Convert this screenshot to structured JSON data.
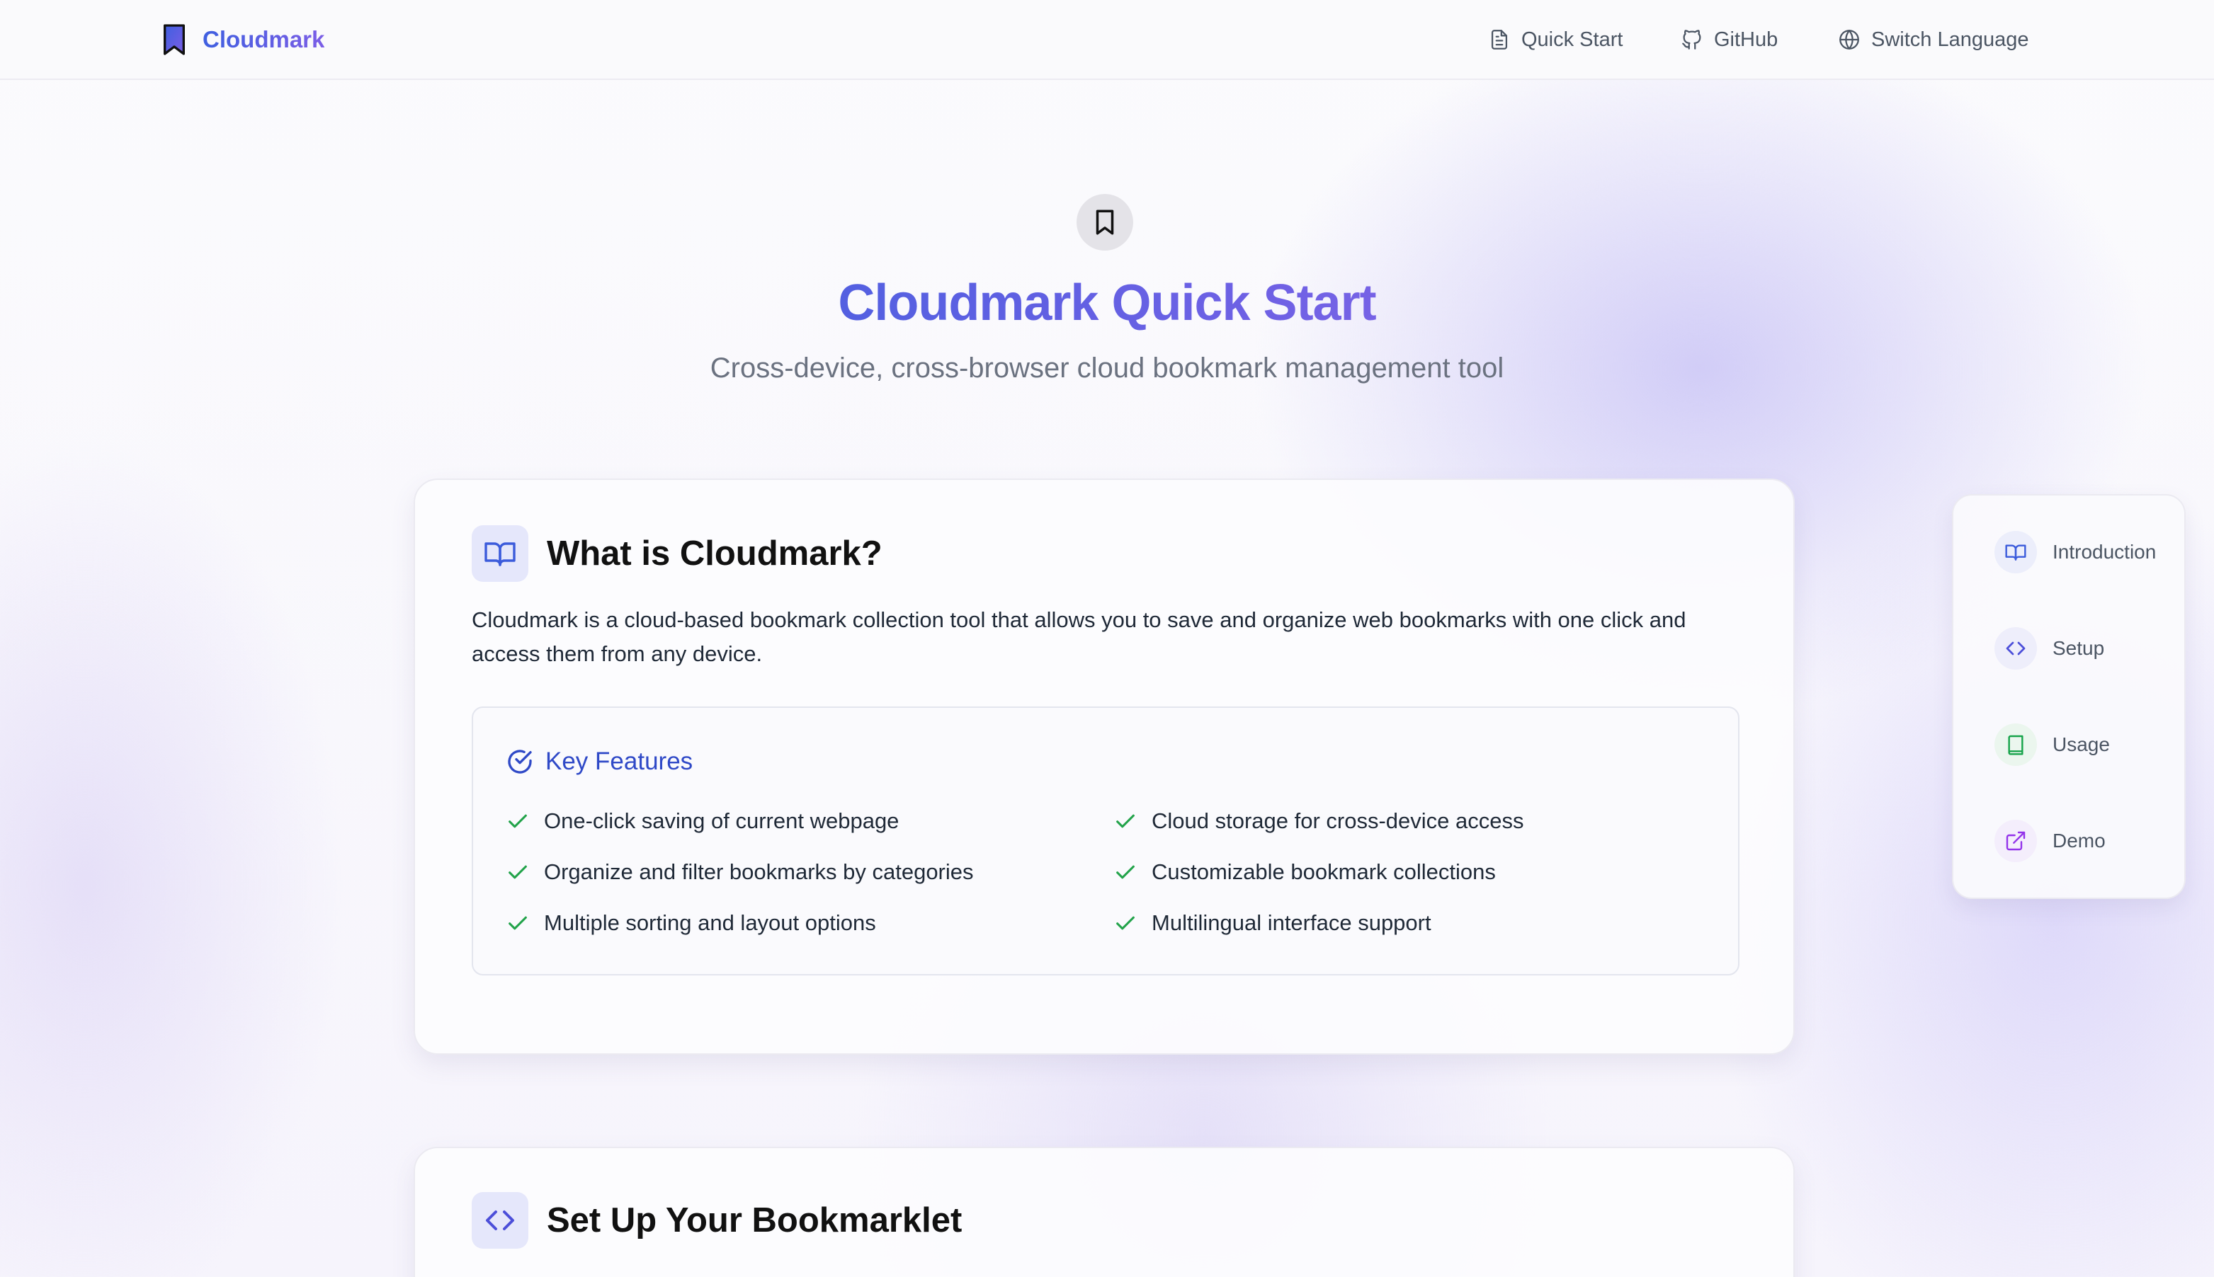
{
  "header": {
    "brand": "Cloudmark",
    "nav": [
      {
        "label": "Quick Start",
        "icon": "document-icon"
      },
      {
        "label": "GitHub",
        "icon": "github-icon"
      },
      {
        "label": "Switch Language",
        "icon": "globe-icon"
      }
    ]
  },
  "hero": {
    "icon": "bookmark-icon",
    "title": "Cloudmark Quick Start",
    "subtitle": "Cross-device, cross-browser cloud bookmark management tool"
  },
  "intro": {
    "icon": "book-open-icon",
    "title": "What is Cloudmark?",
    "description": "Cloudmark is a cloud-based bookmark collection tool that allows you to save and organize web bookmarks with one click and access them from any device.",
    "features_title": "Key Features",
    "features": [
      "One-click saving of current webpage",
      "Cloud storage for cross-device access",
      "Organize and filter bookmarks by categories",
      "Customizable bookmark collections",
      "Multiple sorting and layout options",
      "Multilingual interface support"
    ]
  },
  "setup": {
    "icon": "code-icon",
    "title": "Set Up Your Bookmarklet"
  },
  "sidenav": {
    "items": [
      {
        "label": "Introduction",
        "icon": "book-open-icon",
        "color": "#3b5bdb"
      },
      {
        "label": "Setup",
        "icon": "code-icon",
        "color": "#4c4fd9"
      },
      {
        "label": "Usage",
        "icon": "book-icon",
        "color": "#16a34a"
      },
      {
        "label": "Demo",
        "icon": "external-link-icon",
        "color": "#9333ea"
      }
    ]
  },
  "colors": {
    "brand_gradient_start": "#3f5fe0",
    "brand_gradient_end": "#7b5ee6",
    "check_green": "#22a34a",
    "features_blue": "#2f49c7"
  }
}
